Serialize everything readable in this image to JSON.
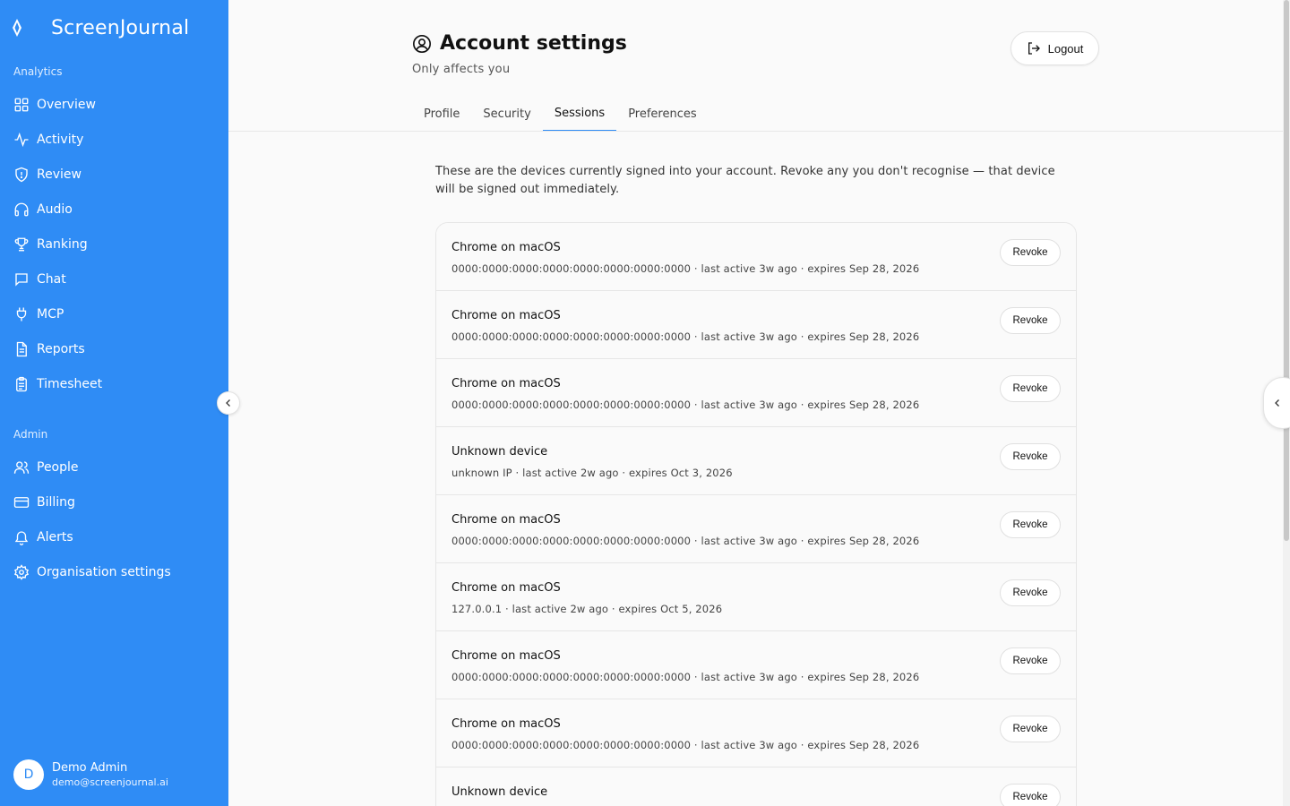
{
  "app": {
    "name": "ScreenJournal"
  },
  "sidebar": {
    "analytics_title": "Analytics",
    "analytics_items": [
      {
        "label": "Overview",
        "icon": "grid-icon"
      },
      {
        "label": "Activity",
        "icon": "activity-icon"
      },
      {
        "label": "Review",
        "icon": "shield-icon"
      },
      {
        "label": "Audio",
        "icon": "headphones-icon"
      },
      {
        "label": "Ranking",
        "icon": "trophy-icon"
      },
      {
        "label": "Chat",
        "icon": "chat-icon"
      },
      {
        "label": "MCP",
        "icon": "plug-icon"
      },
      {
        "label": "Reports",
        "icon": "file-icon"
      },
      {
        "label": "Timesheet",
        "icon": "clipboard-icon"
      }
    ],
    "admin_title": "Admin",
    "admin_items": [
      {
        "label": "People",
        "icon": "users-icon"
      },
      {
        "label": "Billing",
        "icon": "card-icon"
      },
      {
        "label": "Alerts",
        "icon": "bell-icon"
      },
      {
        "label": "Organisation settings",
        "icon": "gear-icon"
      }
    ],
    "user": {
      "initial": "D",
      "name": "Demo Admin",
      "email": "demo@screenjournal.ai"
    }
  },
  "header": {
    "title": "Account settings",
    "subtitle": "Only affects you",
    "logout_label": "Logout"
  },
  "tabs": [
    {
      "label": "Profile",
      "active": false
    },
    {
      "label": "Security",
      "active": false
    },
    {
      "label": "Sessions",
      "active": true
    },
    {
      "label": "Preferences",
      "active": false
    }
  ],
  "sessions_intro": "These are the devices currently signed into your account. Revoke any you don't recognise — that device will be signed out immediately.",
  "sessions": [
    {
      "device": "Chrome on macOS",
      "meta": "0000:0000:0000:0000:0000:0000:0000:0000 · last active 3w ago · expires Sep 28, 2026",
      "action": "Revoke"
    },
    {
      "device": "Chrome on macOS",
      "meta": "0000:0000:0000:0000:0000:0000:0000:0000 · last active 3w ago · expires Sep 28, 2026",
      "action": "Revoke"
    },
    {
      "device": "Chrome on macOS",
      "meta": "0000:0000:0000:0000:0000:0000:0000:0000 · last active 3w ago · expires Sep 28, 2026",
      "action": "Revoke"
    },
    {
      "device": "Unknown device",
      "meta": "unknown IP · last active 2w ago · expires Oct 3, 2026",
      "action": "Revoke"
    },
    {
      "device": "Chrome on macOS",
      "meta": "0000:0000:0000:0000:0000:0000:0000:0000 · last active 3w ago · expires Sep 28, 2026",
      "action": "Revoke"
    },
    {
      "device": "Chrome on macOS",
      "meta": "127.0.0.1 · last active 2w ago · expires Oct 5, 2026",
      "action": "Revoke"
    },
    {
      "device": "Chrome on macOS",
      "meta": "0000:0000:0000:0000:0000:0000:0000:0000 · last active 3w ago · expires Sep 28, 2026",
      "action": "Revoke"
    },
    {
      "device": "Chrome on macOS",
      "meta": "0000:0000:0000:0000:0000:0000:0000:0000 · last active 3w ago · expires Sep 28, 2026",
      "action": "Revoke"
    },
    {
      "device": "Unknown device",
      "meta": "",
      "action": "Revoke"
    }
  ],
  "colors": {
    "accent": "#2f8cf5",
    "sidebar_bg": "#2f8cf5",
    "page_bg": "#fafafa"
  }
}
